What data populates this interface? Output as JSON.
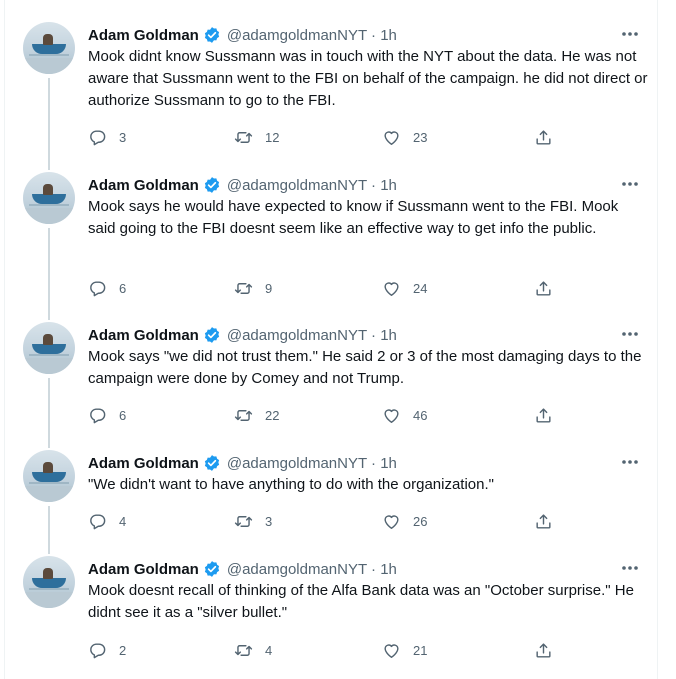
{
  "tweets": [
    {
      "name": "Adam Goldman",
      "handle_time": "@adamgoldmanNYT · 1h",
      "text": "Mook didnt know Sussmann was in touch with the NYT about the data. He was not aware that Sussmann went to the FBI on behalf of the campaign. he did not direct or authorize Sussmann to go to the FBI.",
      "replies": "3",
      "retweets": "12",
      "likes": "23"
    },
    {
      "name": "Adam Goldman",
      "handle_time": "@adamgoldmanNYT · 1h",
      "text": "Mook says he would have expected to know if Sussmann went to the FBI. Mook said going to the FBI doesnt seem like an effective way to get info the public.",
      "replies": "6",
      "retweets": "9",
      "likes": "24"
    },
    {
      "name": "Adam Goldman",
      "handle_time": "@adamgoldmanNYT · 1h",
      "text": "Mook says \"we did not trust them.\" He said 2 or 3 of the most damaging days to the campaign were done by Comey and not Trump.",
      "replies": "6",
      "retweets": "22",
      "likes": "46"
    },
    {
      "name": "Adam Goldman",
      "handle_time": "@adamgoldmanNYT · 1h",
      "text": "\"We didn't want to have anything to do with the organization.\"",
      "replies": "4",
      "retweets": "3",
      "likes": "26"
    },
    {
      "name": "Adam Goldman",
      "handle_time": "@adamgoldmanNYT · 1h",
      "text": "Mook doesnt recall of thinking of the Alfa Bank data was an \"October surprise.\" He didnt see it as a \"silver bullet.\"",
      "replies": "2",
      "retweets": "4",
      "likes": "21"
    }
  ],
  "icons": {
    "verified": "verified-badge-icon",
    "more": "more-options-icon",
    "reply": "reply-icon",
    "retweet": "retweet-icon",
    "like": "like-icon",
    "share": "share-icon"
  },
  "colors": {
    "verified": "#1d9bf0",
    "text": "#0f1419",
    "secondary": "#536471",
    "thread_line": "#cfd9de"
  }
}
